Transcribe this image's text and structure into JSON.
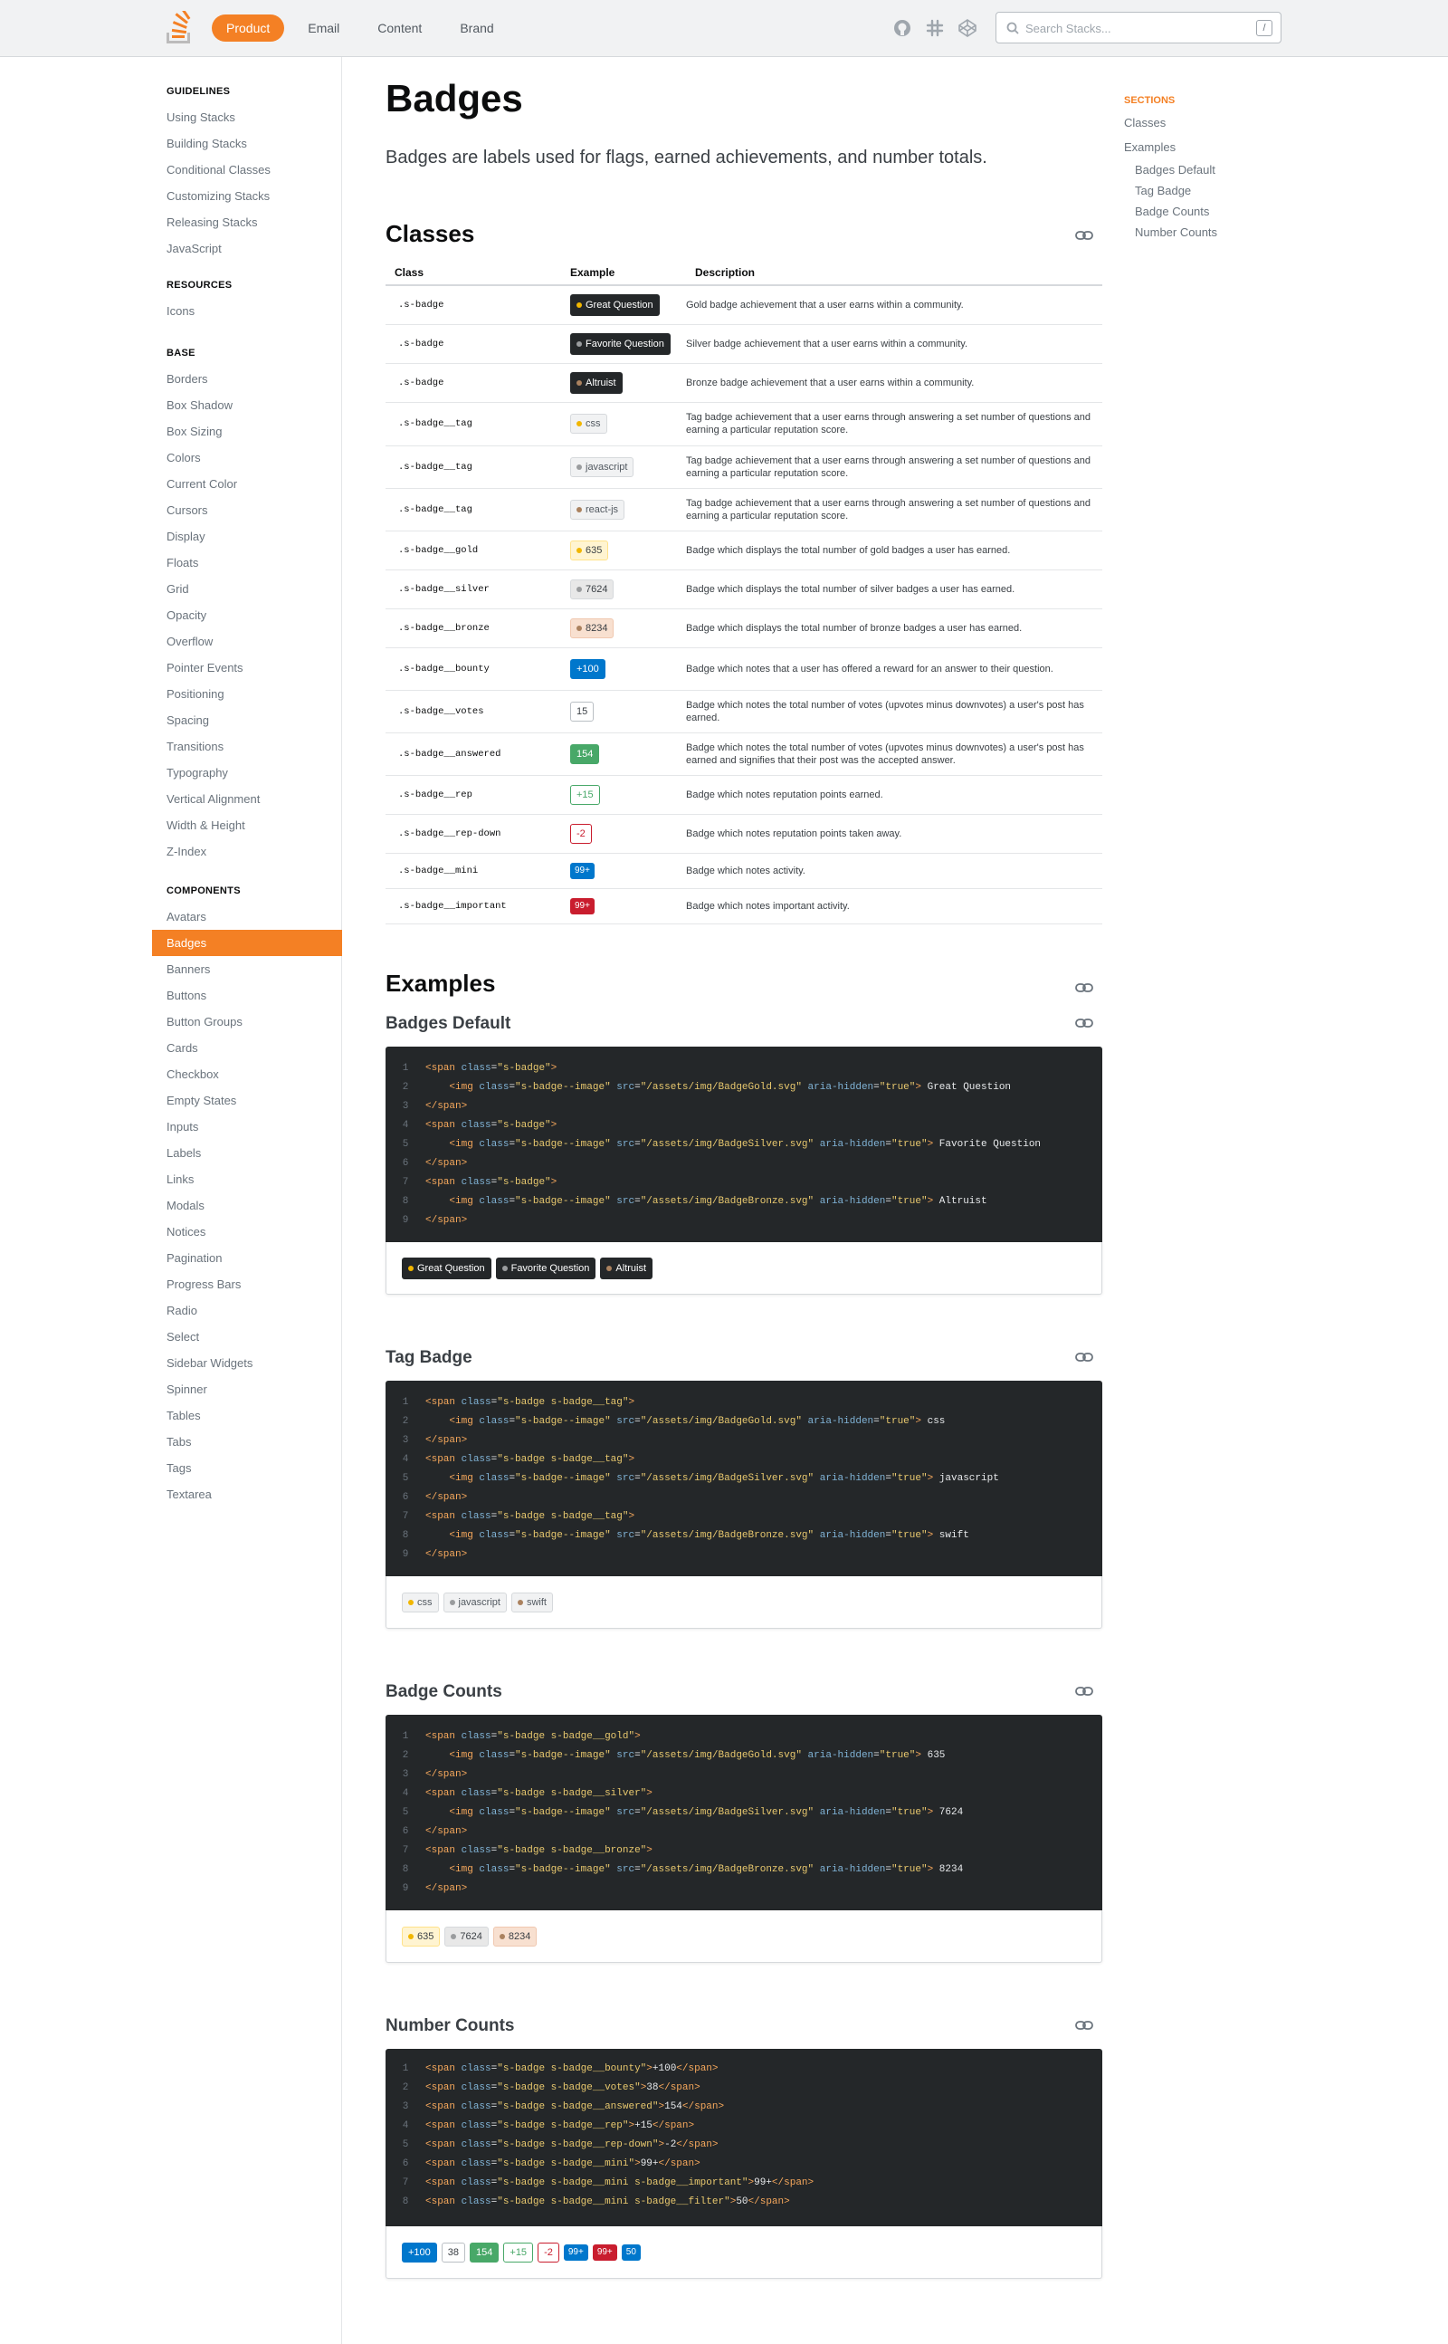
{
  "topbar": {
    "tabs": [
      "Product",
      "Email",
      "Content",
      "Brand"
    ],
    "active_tab": "Product",
    "icons": [
      "github-icon",
      "slack-icon",
      "codepen-icon"
    ],
    "search_placeholder": "Search Stacks...",
    "search_shortcut": "/",
    "colors": {
      "brand": "#f48024"
    }
  },
  "sidebar": {
    "groups": [
      {
        "title": "GUIDELINES",
        "items": [
          "Using Stacks",
          "Building Stacks",
          "Conditional Classes",
          "Customizing Stacks",
          "Releasing Stacks",
          "JavaScript"
        ]
      },
      {
        "title": "RESOURCES",
        "items": [
          "Icons"
        ]
      },
      {
        "title": "BASE",
        "items": [
          "Borders",
          "Box Shadow",
          "Box Sizing",
          "Colors",
          "Current Color",
          "Cursors",
          "Display",
          "Floats",
          "Grid",
          "Opacity",
          "Overflow",
          "Pointer Events",
          "Positioning",
          "Spacing",
          "Transitions",
          "Typography",
          "Vertical Alignment",
          "Width & Height",
          "Z-Index"
        ]
      },
      {
        "title": "COMPONENTS",
        "items": [
          "Avatars",
          "Badges",
          "Banners",
          "Buttons",
          "Button Groups",
          "Cards",
          "Checkbox",
          "Empty States",
          "Inputs",
          "Labels",
          "Links",
          "Modals",
          "Notices",
          "Pagination",
          "Progress Bars",
          "Radio",
          "Select",
          "Sidebar Widgets",
          "Spinner",
          "Tables",
          "Tabs",
          "Tags",
          "Textarea"
        ]
      }
    ],
    "active_item": "Badges"
  },
  "page": {
    "title": "Badges",
    "lede": "Badges are labels used for flags, earned achievements, and number totals."
  },
  "classes": {
    "heading": "Classes",
    "columns": [
      "Class",
      "Example",
      "Description"
    ],
    "rows": [
      {
        "cls": ".s-badge",
        "badge": "Great Question",
        "style": "dark",
        "dot": "#f1b600",
        "desc": "Gold badge achievement that a user earns within a community."
      },
      {
        "cls": ".s-badge",
        "badge": "Favorite Question",
        "style": "dark",
        "dot": "#9a9c9e",
        "desc": "Silver badge achievement that a user earns within a community."
      },
      {
        "cls": ".s-badge",
        "badge": "Altruist",
        "style": "dark",
        "dot": "#ab825f",
        "desc": "Bronze badge achievement that a user earns within a community."
      },
      {
        "cls": ".s-badge__tag",
        "badge": "css",
        "style": "tag",
        "dot": "#f1b600",
        "desc": "Tag badge achievement that a user earns through answering a set number of questions and earning a particular reputation score."
      },
      {
        "cls": ".s-badge__tag",
        "badge": "javascript",
        "style": "tag",
        "dot": "#9a9c9e",
        "desc": "Tag badge achievement that a user earns through answering a set number of questions and earning a particular reputation score."
      },
      {
        "cls": ".s-badge__tag",
        "badge": "react-js",
        "style": "tag",
        "dot": "#ab825f",
        "desc": "Tag badge achievement that a user earns through answering a set number of questions and earning a particular reputation score."
      },
      {
        "cls": ".s-badge__gold",
        "badge": "635",
        "style": "gold",
        "dot": "#f1b600",
        "desc": "Badge which displays the total number of gold badges a user has earned."
      },
      {
        "cls": ".s-badge__silver",
        "badge": "7624",
        "style": "silver",
        "dot": "#9a9c9e",
        "desc": "Badge which displays the total number of silver badges a user has earned."
      },
      {
        "cls": ".s-badge__bronze",
        "badge": "8234",
        "style": "bronze",
        "dot": "#ab825f",
        "desc": "Badge which displays the total number of bronze badges a user has earned."
      },
      {
        "cls": ".s-badge__bounty",
        "badge": "+100",
        "style": "bounty",
        "dot": "",
        "desc": "Badge which notes that a user has offered a reward for an answer to their question."
      },
      {
        "cls": ".s-badge__votes",
        "badge": "15",
        "style": "votes",
        "dot": "",
        "desc": "Badge which notes the total number of votes (upvotes minus downvotes) a user's post has earned."
      },
      {
        "cls": ".s-badge__answered",
        "badge": "154",
        "style": "answered",
        "dot": "",
        "desc": "Badge which notes the total number of votes (upvotes minus downvotes) a user's post has earned and signifies that their post was the accepted answer."
      },
      {
        "cls": ".s-badge__rep",
        "badge": "+15",
        "style": "rep",
        "dot": "",
        "desc": "Badge which notes reputation points earned."
      },
      {
        "cls": ".s-badge__rep-down",
        "badge": "-2",
        "style": "repdown",
        "dot": "",
        "desc": "Badge which notes reputation points taken away."
      },
      {
        "cls": ".s-badge__mini",
        "badge": "99+",
        "style": "mini",
        "dot": "",
        "desc": "Badge which notes activity."
      },
      {
        "cls": ".s-badge__important",
        "badge": "99+",
        "style": "important",
        "dot": "",
        "desc": "Badge which notes important activity."
      }
    ]
  },
  "examples": {
    "heading": "Examples",
    "sections": [
      {
        "title": "Badges Default",
        "code": [
          "<span class=\"s-badge\">",
          "    <img class=\"s-badge--image\" src=\"/assets/img/BadgeGold.svg\" aria-hidden=\"true\"> Great Question",
          "</span>",
          "<span class=\"s-badge\">",
          "    <img class=\"s-badge--image\" src=\"/assets/img/BadgeSilver.svg\" aria-hidden=\"true\"> Favorite Question",
          "</span>",
          "<span class=\"s-badge\">",
          "    <img class=\"s-badge--image\" src=\"/assets/img/BadgeBronze.svg\" aria-hidden=\"true\"> Altruist",
          "</span>"
        ],
        "demo": [
          {
            "label": "Great Question",
            "style": "dark",
            "dot": "#f1b600"
          },
          {
            "label": "Favorite Question",
            "style": "dark",
            "dot": "#9a9c9e"
          },
          {
            "label": "Altruist",
            "style": "dark",
            "dot": "#ab825f"
          }
        ]
      },
      {
        "title": "Tag Badge",
        "code": [
          "<span class=\"s-badge s-badge__tag\">",
          "    <img class=\"s-badge--image\" src=\"/assets/img/BadgeGold.svg\" aria-hidden=\"true\"> css",
          "</span>",
          "<span class=\"s-badge s-badge__tag\">",
          "    <img class=\"s-badge--image\" src=\"/assets/img/BadgeSilver.svg\" aria-hidden=\"true\"> javascript",
          "</span>",
          "<span class=\"s-badge s-badge__tag\">",
          "    <img class=\"s-badge--image\" src=\"/assets/img/BadgeBronze.svg\" aria-hidden=\"true\"> swift",
          "</span>"
        ],
        "demo": [
          {
            "label": "css",
            "style": "tag",
            "dot": "#f1b600"
          },
          {
            "label": "javascript",
            "style": "tag",
            "dot": "#9a9c9e"
          },
          {
            "label": "swift",
            "style": "tag",
            "dot": "#ab825f"
          }
        ]
      },
      {
        "title": "Badge Counts",
        "code": [
          "<span class=\"s-badge s-badge__gold\">",
          "    <img class=\"s-badge--image\" src=\"/assets/img/BadgeGold.svg\" aria-hidden=\"true\"> 635",
          "</span>",
          "<span class=\"s-badge s-badge__silver\">",
          "    <img class=\"s-badge--image\" src=\"/assets/img/BadgeSilver.svg\" aria-hidden=\"true\"> 7624",
          "</span>",
          "<span class=\"s-badge s-badge__bronze\">",
          "    <img class=\"s-badge--image\" src=\"/assets/img/BadgeBronze.svg\" aria-hidden=\"true\"> 8234",
          "</span>"
        ],
        "demo": [
          {
            "label": "635",
            "style": "gold",
            "dot": "#f1b600"
          },
          {
            "label": "7624",
            "style": "silver",
            "dot": "#9a9c9e"
          },
          {
            "label": "8234",
            "style": "bronze",
            "dot": "#ab825f"
          }
        ]
      },
      {
        "title": "Number Counts",
        "code": [
          "<span class=\"s-badge s-badge__bounty\">+100</span>",
          "<span class=\"s-badge s-badge__votes\">38</span>",
          "<span class=\"s-badge s-badge__answered\">154</span>",
          "<span class=\"s-badge s-badge__rep\">+15</span>",
          "<span class=\"s-badge s-badge__rep-down\">-2</span>",
          "<span class=\"s-badge s-badge__mini\">99+</span>",
          "<span class=\"s-badge s-badge__mini s-badge__important\">99+</span>",
          "<span class=\"s-badge s-badge__mini s-badge__filter\">50</span>"
        ],
        "demo": [
          {
            "label": "+100",
            "style": "bounty",
            "dot": ""
          },
          {
            "label": "38",
            "style": "votes",
            "dot": ""
          },
          {
            "label": "154",
            "style": "answered",
            "dot": ""
          },
          {
            "label": "+15",
            "style": "rep",
            "dot": ""
          },
          {
            "label": "-2",
            "style": "repdown",
            "dot": ""
          },
          {
            "label": "99+",
            "style": "mini",
            "dot": ""
          },
          {
            "label": "99+",
            "style": "important",
            "dot": ""
          },
          {
            "label": "50",
            "style": "mini",
            "dot": ""
          }
        ]
      }
    ]
  },
  "toc": {
    "heading": "SECTIONS",
    "items": [
      {
        "label": "Classes",
        "sub": false
      },
      {
        "label": "Examples",
        "sub": false
      },
      {
        "label": "Badges Default",
        "sub": true
      },
      {
        "label": "Tag Badge",
        "sub": true
      },
      {
        "label": "Badge Counts",
        "sub": true
      },
      {
        "label": "Number Counts",
        "sub": true
      }
    ]
  }
}
